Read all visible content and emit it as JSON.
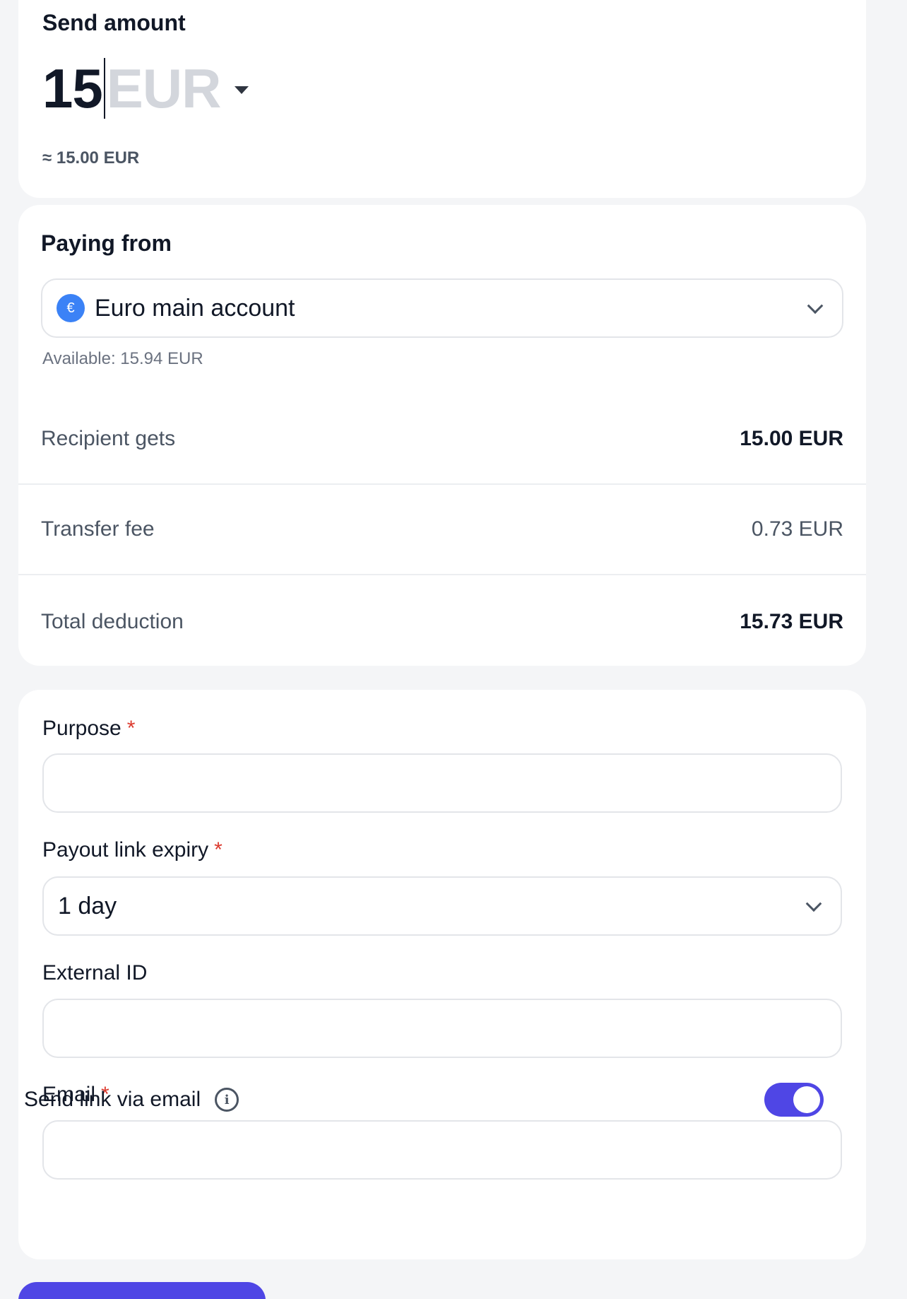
{
  "send_amount": {
    "title": "Send amount",
    "amount_value": "15",
    "currency": "EUR",
    "approx": "≈ 15.00 EUR"
  },
  "paying_from": {
    "title": "Paying from",
    "account_icon": "€",
    "account_name": "Euro main account",
    "available": "Available: 15.94 EUR"
  },
  "summary": {
    "recipient_label": "Recipient gets",
    "recipient_value": "15.00 EUR",
    "fee_label": "Transfer fee",
    "fee_value": "0.73 EUR",
    "total_label": "Total deduction",
    "total_value": "15.73 EUR"
  },
  "form": {
    "purpose_label": "Purpose",
    "purpose_value": "",
    "expiry_label": "Payout link expiry",
    "expiry_value": "1 day",
    "external_id_label": "External ID",
    "external_id_value": "",
    "email_label": "Email",
    "email_value": "",
    "required_marker": "*",
    "send_link_label": "Send link via email",
    "info_icon": "i",
    "send_link_enabled": true
  },
  "colors": {
    "accent": "#4f46e5",
    "euro_badge": "#3b82f6",
    "required": "#dc3b2f"
  }
}
